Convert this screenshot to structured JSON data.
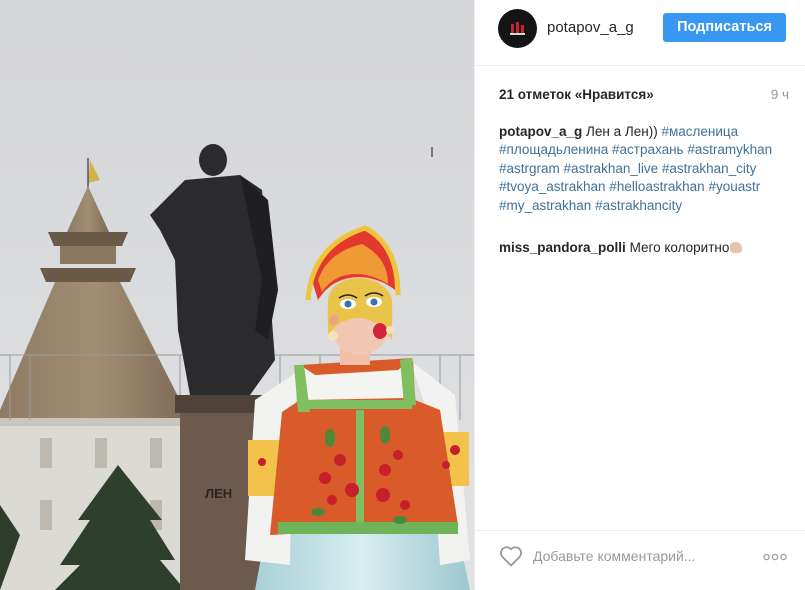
{
  "post": {
    "username": "potapov_a_g",
    "follow_label": "Подписаться",
    "likes": "21 отметок «Нравится»",
    "time": "9 ч",
    "caption": {
      "user": "potapov_a_g",
      "text": "Лен а Лен))",
      "tags": [
        "#масленица",
        "#площадьленина",
        "#астрахань",
        "#astramykhan",
        "#astrgram",
        "#astrakhan_live",
        "#astrakhan_city",
        "#tvoya_astrakhan",
        "#helloastrakhan",
        "#youastr",
        "#my_astrakhan",
        "#astrakhancity"
      ]
    },
    "comment": {
      "user": "miss_pandora_polli",
      "text": "Мего колоритно"
    },
    "photo_text": "ЛЕН"
  },
  "footer": {
    "comment_placeholder": "Добавьте комментарий..."
  },
  "icons": {
    "avatar": "avatar-icon",
    "like": "heart-icon",
    "more": "more-options-icon",
    "emoji": "clap-emoji-icon"
  },
  "colors": {
    "accent": "#3897f0",
    "hashtag": "#3f729b",
    "text": "#262626",
    "muted": "#999999",
    "divider": "#efefef"
  }
}
